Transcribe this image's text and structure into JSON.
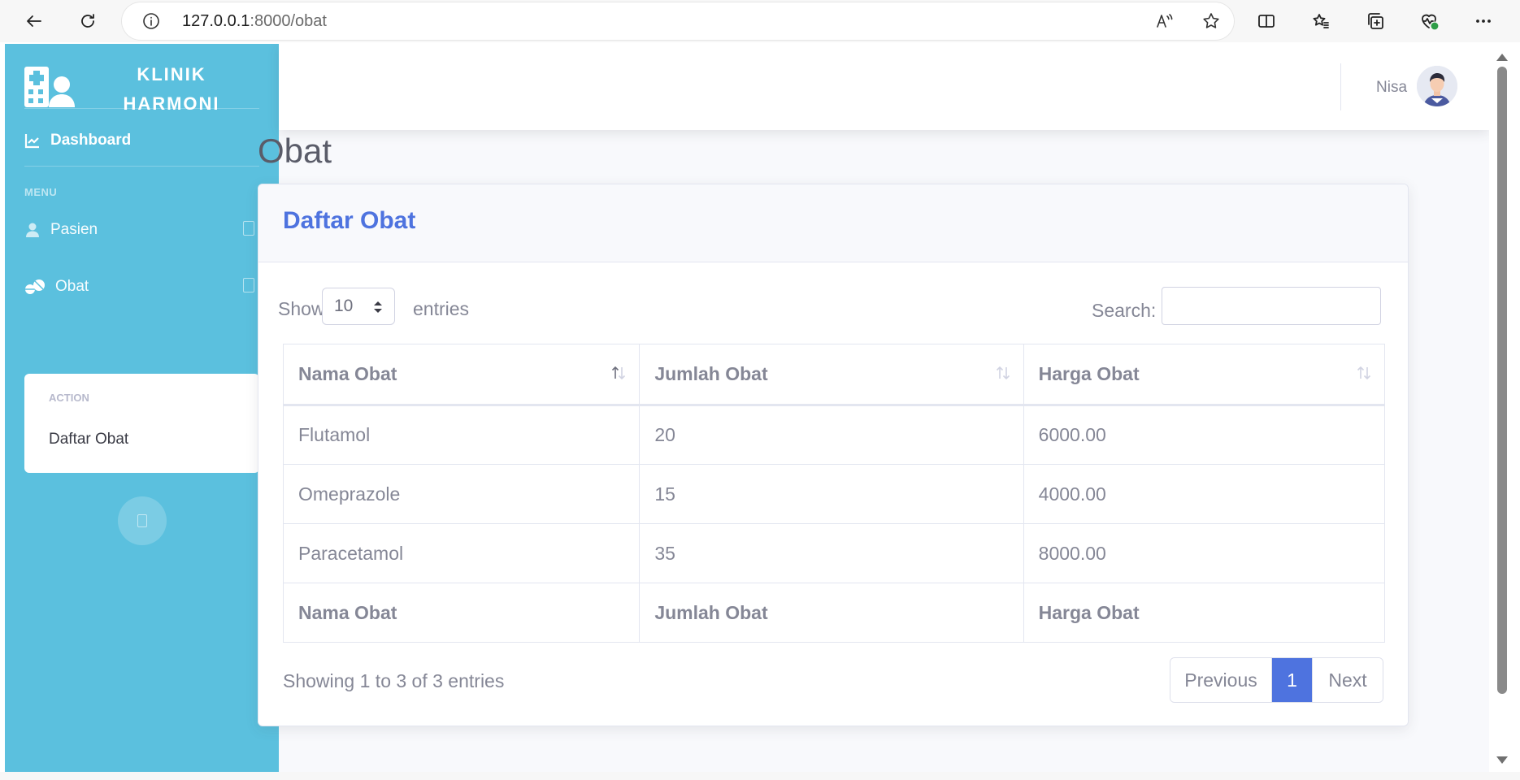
{
  "browser": {
    "url_host": "127.0.0.1",
    "url_path": ":8000/obat"
  },
  "sidebar": {
    "brand_line1": "KLINIK",
    "brand_line2": "HARMONI",
    "dashboard_label": "Dashboard",
    "menu_heading": "MENU",
    "items": [
      {
        "label": "Pasien",
        "icon": "user-injured-icon"
      },
      {
        "label": "Obat",
        "icon": "pills-icon"
      }
    ],
    "submenu": {
      "header": "ACTION",
      "items": [
        {
          "label": "Daftar Obat"
        }
      ]
    }
  },
  "topbar": {
    "username": "Nisa"
  },
  "main": {
    "page_title": "Obat",
    "card_title": "Daftar Obat",
    "show_label": "Show",
    "entries_label": "entries",
    "length_value": "10",
    "search_label": "Search:",
    "search_value": "",
    "table": {
      "columns": [
        "Nama Obat",
        "Jumlah Obat",
        "Harga Obat"
      ],
      "rows": [
        [
          "Flutamol",
          "20",
          "6000.00"
        ],
        [
          "Omeprazole",
          "15",
          "4000.00"
        ],
        [
          "Paracetamol",
          "35",
          "8000.00"
        ]
      ],
      "sorted_column": 0,
      "sort_direction": "ascending"
    },
    "info": "Showing 1 to 3 of 3 entries",
    "pagination": {
      "previous": "Previous",
      "current": "1",
      "next": "Next"
    }
  },
  "colors": {
    "sidebar": "#5bc0de",
    "primary": "#4e73df",
    "text_muted": "#858796",
    "page_bg": "#f8f9fc"
  }
}
